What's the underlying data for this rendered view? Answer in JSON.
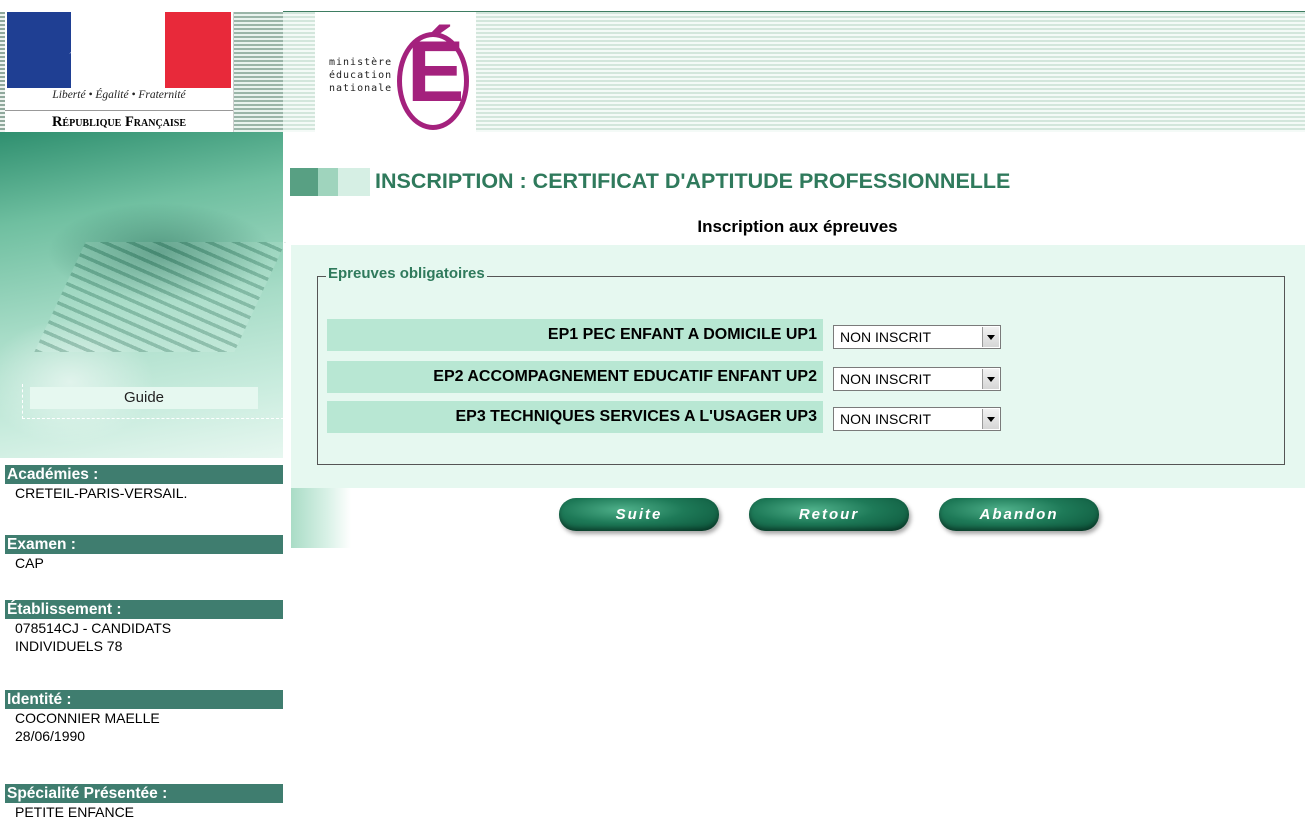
{
  "header": {
    "republic_motto": "Liberté • Égalité • Fraternité",
    "republic_name": "République Française",
    "ministry_line1": "ministère",
    "ministry_line2": "éducation",
    "ministry_line3": "nationale",
    "ministry_letter": "É"
  },
  "sidebar": {
    "guide_label": "Guide",
    "academies": {
      "title": "Académies :",
      "value": "CRETEIL-PARIS-VERSAIL."
    },
    "examen": {
      "title": "Examen :",
      "value": "CAP"
    },
    "etablissement": {
      "title": "Établissement :",
      "value_line1": "078514CJ - CANDIDATS",
      "value_line2": "INDIVIDUELS 78"
    },
    "identite": {
      "title": "Identité :",
      "value_line1": "COCONNIER MAELLE",
      "value_line2": "28/06/1990"
    },
    "specialite": {
      "title": "Spécialité Présentée :",
      "value": "PETITE ENFANCE"
    }
  },
  "main": {
    "title": "INSCRIPTION : CERTIFICAT D'APTITUDE PROFESSIONNELLE",
    "subtitle": "Inscription aux épreuves",
    "fieldset_legend": "Epreuves obligatoires",
    "epreuves": [
      {
        "label": "EP1  PEC ENFANT A DOMICILE   UP1",
        "selected": "NON INSCRIT"
      },
      {
        "label": "EP2  ACCOMPAGNEMENT EDUCATIF ENFANT   UP2",
        "selected": "NON INSCRIT"
      },
      {
        "label": "EP3  TECHNIQUES SERVICES A L'USAGER   UP3",
        "selected": "NON INSCRIT"
      }
    ],
    "buttons": {
      "suite": "Suite",
      "retour": "Retour",
      "abandon": "Abandon"
    }
  },
  "colors": {
    "accent_green": "#2f7a5c",
    "panel_bg": "#e6f8f0",
    "label_bg": "#b8e7d3",
    "sidebar_title_bg": "#3f7d6f",
    "ministry_magenta": "#a4217d",
    "flag_blue": "#1f3f93",
    "flag_red": "#e8293a"
  }
}
